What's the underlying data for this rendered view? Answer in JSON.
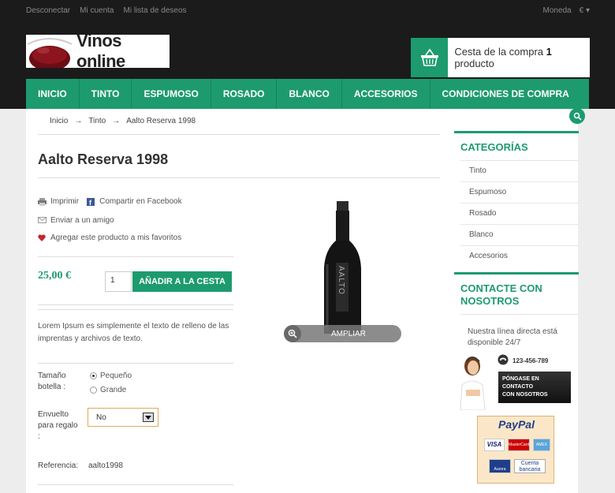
{
  "top_links": [
    "Desconectar",
    "Mi cuenta",
    "Mi lista de deseos"
  ],
  "currency": {
    "label": "Moneda",
    "value": "€"
  },
  "logo": {
    "text": "Vinos online"
  },
  "cart": {
    "label": "Cesta de la compra",
    "count": "1",
    "unit": "producto"
  },
  "nav": [
    "INICIO",
    "TINTO",
    "ESPUMOSO",
    "ROSADO",
    "BLANCO",
    "ACCESORIOS",
    "CONDICIONES DE COMPRA"
  ],
  "breadcrumb": [
    "Inicio",
    "Tinto",
    "Aalto Reserva 1998"
  ],
  "product": {
    "title": "Aalto Reserva 1998",
    "actions": {
      "print": "Imprimir",
      "facebook": "Compartir en Facebook",
      "email": "Enviar a un amigo",
      "favorite": "Agregar este producto a mis favoritos"
    },
    "price": "25,00 €",
    "quantity": "1",
    "add_button": "AÑADIR A LA CESTA",
    "description": "Lorem Ipsum es simplemente el texto de relleno de las imprentas y archivos de texto.",
    "size_label": "Tamaño botella :",
    "size_options": [
      "Pequeño",
      "Grande"
    ],
    "gift_label": "Envuelto para regalo :",
    "gift_value": "No",
    "ref_label": "Referencia:",
    "ref_value": "aalto1998",
    "zoom_label": "AMPLIAR",
    "bottle_label": "AALTO"
  },
  "sidebar": {
    "categories_title": "CATEGORÍAS",
    "categories": [
      "Tinto",
      "Espumoso",
      "Rosado",
      "Blanco",
      "Accesorios"
    ],
    "contact_title_1": "CONTACTE CON",
    "contact_title_2": "NOSOTROS",
    "contact_text": "Nuestra línea directa está disponible 24/7",
    "phone": "123-456-789",
    "contact_button": [
      "PÓNGASE EN",
      "CONTACTO",
      "CON NOSOTROS"
    ],
    "paypal": {
      "title": "PayPal",
      "cards": [
        "VISA",
        "MasterCard",
        "AMEX",
        "Aurora",
        "Cuenta bancaria"
      ]
    }
  },
  "colors": {
    "accent": "#1d9b6e",
    "dark": "#1b1b1b"
  }
}
